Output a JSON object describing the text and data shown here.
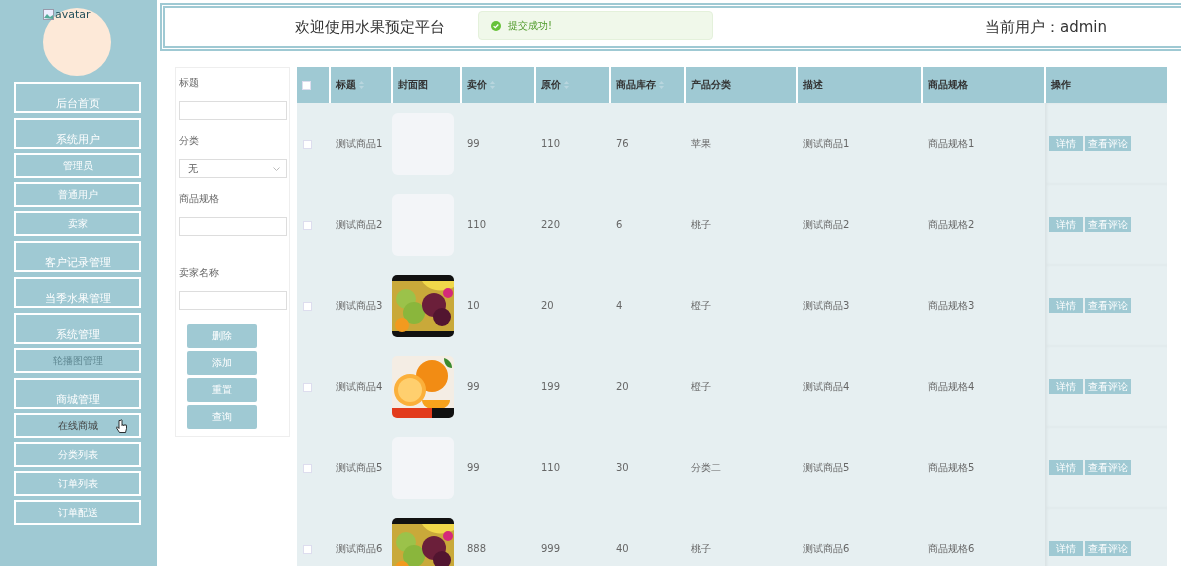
{
  "sidebar": {
    "avatar_alt": "avatar",
    "items": [
      {
        "label": "后台首页",
        "kind": "menu",
        "disabled": false,
        "hovered": false
      },
      {
        "label": "系统用户",
        "kind": "menu",
        "disabled": false,
        "hovered": false
      },
      {
        "label": "管理员",
        "kind": "submenu",
        "disabled": false,
        "hovered": false
      },
      {
        "label": "普通用户",
        "kind": "submenu",
        "disabled": false,
        "hovered": false
      },
      {
        "label": "卖家",
        "kind": "submenu",
        "disabled": false,
        "hovered": false
      },
      {
        "label": "客户记录管理",
        "kind": "menu",
        "disabled": false,
        "hovered": false
      },
      {
        "label": "当季水果管理",
        "kind": "menu",
        "disabled": false,
        "hovered": false
      },
      {
        "label": "系统管理",
        "kind": "menu",
        "disabled": false,
        "hovered": false
      },
      {
        "label": "轮播图管理",
        "kind": "submenu",
        "disabled": true,
        "hovered": false
      },
      {
        "label": "商城管理",
        "kind": "menu",
        "disabled": false,
        "hovered": false
      },
      {
        "label": "在线商城",
        "kind": "submenu",
        "disabled": false,
        "hovered": true
      },
      {
        "label": "分类列表",
        "kind": "submenu",
        "disabled": false,
        "hovered": false
      },
      {
        "label": "订单列表",
        "kind": "submenu",
        "disabled": false,
        "hovered": false
      },
      {
        "label": "订单配送",
        "kind": "submenu",
        "disabled": false,
        "hovered": false
      }
    ]
  },
  "header": {
    "title": "欢迎使用水果预定平台",
    "user": "当前用户：admin"
  },
  "toast": {
    "message": "提交成功!"
  },
  "filters": {
    "fields": [
      {
        "label": "标题",
        "kind": "text"
      },
      {
        "label": "分类",
        "kind": "select",
        "value": "无"
      },
      {
        "label": "商品规格",
        "kind": "text"
      },
      {
        "label": "卖家名称",
        "kind": "text"
      }
    ],
    "buttons": [
      "删除",
      "添加",
      "重置",
      "查询"
    ]
  },
  "table": {
    "header_checked": false,
    "columns": [
      {
        "label": "标题",
        "sortable": true
      },
      {
        "label": "封面图",
        "sortable": false
      },
      {
        "label": "卖价",
        "sortable": true
      },
      {
        "label": "原价",
        "sortable": true
      },
      {
        "label": "商品库存",
        "sortable": true
      },
      {
        "label": "产品分类",
        "sortable": false
      },
      {
        "label": "描述",
        "sortable": false
      },
      {
        "label": "商品规格",
        "sortable": false
      },
      {
        "label": "操作",
        "sortable": false
      }
    ],
    "rows": [
      {
        "checked": false,
        "title": "测试商品1",
        "cover": {
          "kind": "empty"
        },
        "price": "99",
        "original_price": "110",
        "stock": "76",
        "category": "苹果",
        "description": "测试商品1",
        "spec": "商品规格1",
        "actions": [
          "详情",
          "查看评论"
        ]
      },
      {
        "checked": false,
        "title": "测试商品2",
        "cover": {
          "kind": "empty"
        },
        "price": "110",
        "original_price": "220",
        "stock": "6",
        "category": "桃子",
        "description": "测试商品2",
        "spec": "商品规格2",
        "actions": [
          "详情",
          "查看评论"
        ]
      },
      {
        "checked": false,
        "title": "测试商品3",
        "price": "10",
        "original_price": "20",
        "stock": "4",
        "category": "橙子",
        "description": "测试商品3",
        "spec": "商品规格3",
        "actions": [
          "详情",
          "查看评论"
        ]
      },
      {
        "checked": false,
        "title": "测试商品4",
        "price": "99",
        "original_price": "199",
        "stock": "20",
        "category": "橙子",
        "description": "测试商品4",
        "spec": "商品规格4",
        "actions": [
          "详情",
          "查看评论"
        ]
      },
      {
        "checked": false,
        "title": "测试商品5",
        "cover": {
          "kind": "empty"
        },
        "price": "99",
        "original_price": "110",
        "stock": "30",
        "category": "分类二",
        "description": "测试商品5",
        "spec": "商品规格5",
        "actions": [
          "详情",
          "查看评论"
        ]
      },
      {
        "checked": false,
        "title": "测试商品6",
        "price": "888",
        "original_price": "999",
        "stock": "40",
        "category": "桃子",
        "description": "测试商品6",
        "spec": "商品规格6",
        "actions": [
          "详情",
          "查看评论"
        ]
      }
    ]
  }
}
